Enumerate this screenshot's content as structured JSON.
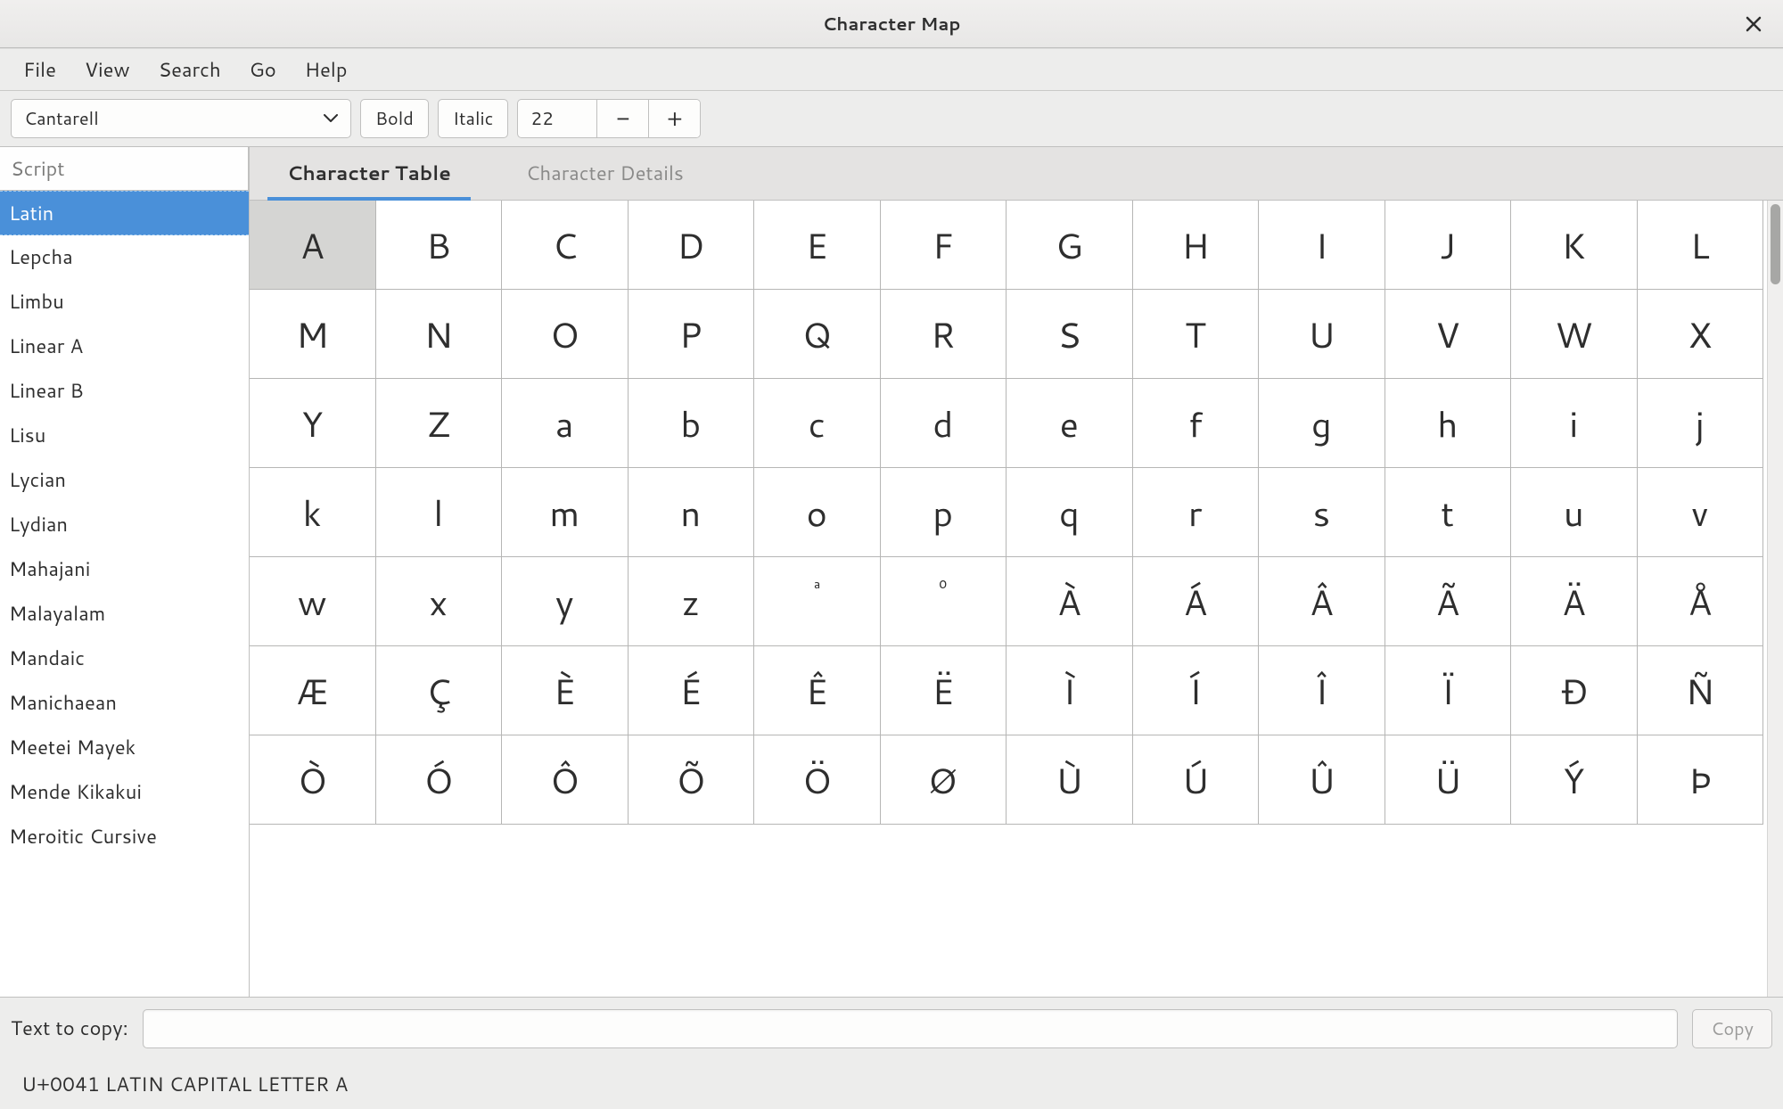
{
  "window": {
    "title": "Character Map"
  },
  "menubar": {
    "items": [
      "File",
      "View",
      "Search",
      "Go",
      "Help"
    ]
  },
  "toolbar": {
    "font": "Cantarell",
    "bold_label": "Bold",
    "italic_label": "Italic",
    "size": "22",
    "minus": "−",
    "plus": "+"
  },
  "sidebar": {
    "header": "Script",
    "selected_index": 0,
    "items": [
      "Latin",
      "Lepcha",
      "Limbu",
      "Linear A",
      "Linear B",
      "Lisu",
      "Lycian",
      "Lydian",
      "Mahajani",
      "Malayalam",
      "Mandaic",
      "Manichaean",
      "Meetei Mayek",
      "Mende Kikakui",
      "Meroitic Cursive"
    ]
  },
  "tabs": {
    "items": [
      "Character Table",
      "Character Details"
    ],
    "active_index": 0
  },
  "grid": {
    "columns": 12,
    "selected": [
      0,
      0
    ],
    "rows": [
      [
        "A",
        "B",
        "C",
        "D",
        "E",
        "F",
        "G",
        "H",
        "I",
        "J",
        "K",
        "L"
      ],
      [
        "M",
        "N",
        "O",
        "P",
        "Q",
        "R",
        "S",
        "T",
        "U",
        "V",
        "W",
        "X"
      ],
      [
        "Y",
        "Z",
        "a",
        "b",
        "c",
        "d",
        "e",
        "f",
        "g",
        "h",
        "i",
        "j"
      ],
      [
        "k",
        "l",
        "m",
        "n",
        "o",
        "p",
        "q",
        "r",
        "s",
        "t",
        "u",
        "v"
      ],
      [
        "w",
        "x",
        "y",
        "z",
        "ª",
        "º",
        "À",
        "Á",
        "Â",
        "Ã",
        "Ä",
        "Å"
      ],
      [
        "Æ",
        "Ç",
        "È",
        "É",
        "Ê",
        "Ë",
        "Ì",
        "Í",
        "Î",
        "Ï",
        "Ð",
        "Ñ"
      ],
      [
        "Ò",
        "Ó",
        "Ô",
        "Õ",
        "Ö",
        "Ø",
        "Ù",
        "Ú",
        "Û",
        "Ü",
        "Ý",
        "Þ"
      ]
    ],
    "small_cells": [
      [
        4,
        4
      ],
      [
        4,
        5
      ]
    ]
  },
  "copybar": {
    "label": "Text to copy:",
    "value": "",
    "button": "Copy"
  },
  "statusbar": {
    "text": "U+0041 LATIN CAPITAL LETTER A"
  }
}
